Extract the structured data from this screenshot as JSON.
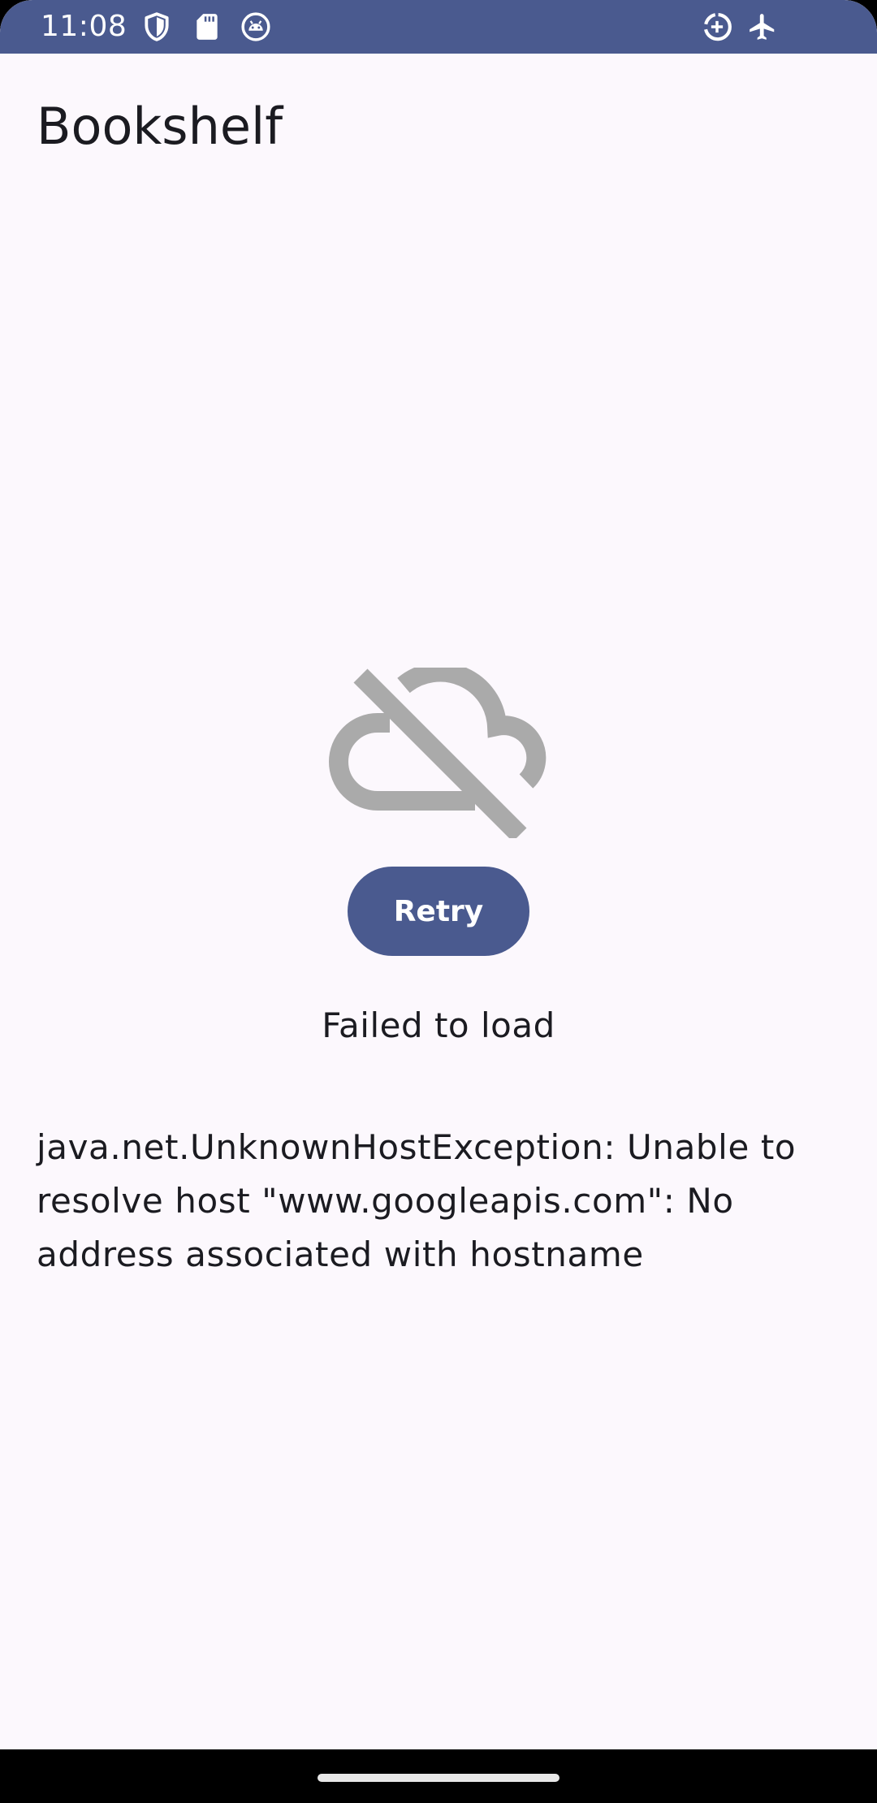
{
  "status_bar": {
    "time": "11:08",
    "background_color": "#4A5A8F",
    "left_icons": [
      "shield-icon",
      "sd-card-icon",
      "android-debug-icon"
    ],
    "right_icons": [
      "data-saver-icon",
      "airplane-mode-icon"
    ]
  },
  "app_bar": {
    "title": "Bookshelf"
  },
  "error_state": {
    "icon": "cloud-off-icon",
    "icon_color": "#AAAAAA",
    "retry_label": "Retry",
    "message": "Failed to load",
    "detail": "java.net.UnknownHostException: Unable to resolve host \"www.googleapis.com\": No address associated with hostname"
  },
  "colors": {
    "primary": "#4A5A8F",
    "background": "#FCF8FD",
    "on_background": "#1B1B21"
  }
}
